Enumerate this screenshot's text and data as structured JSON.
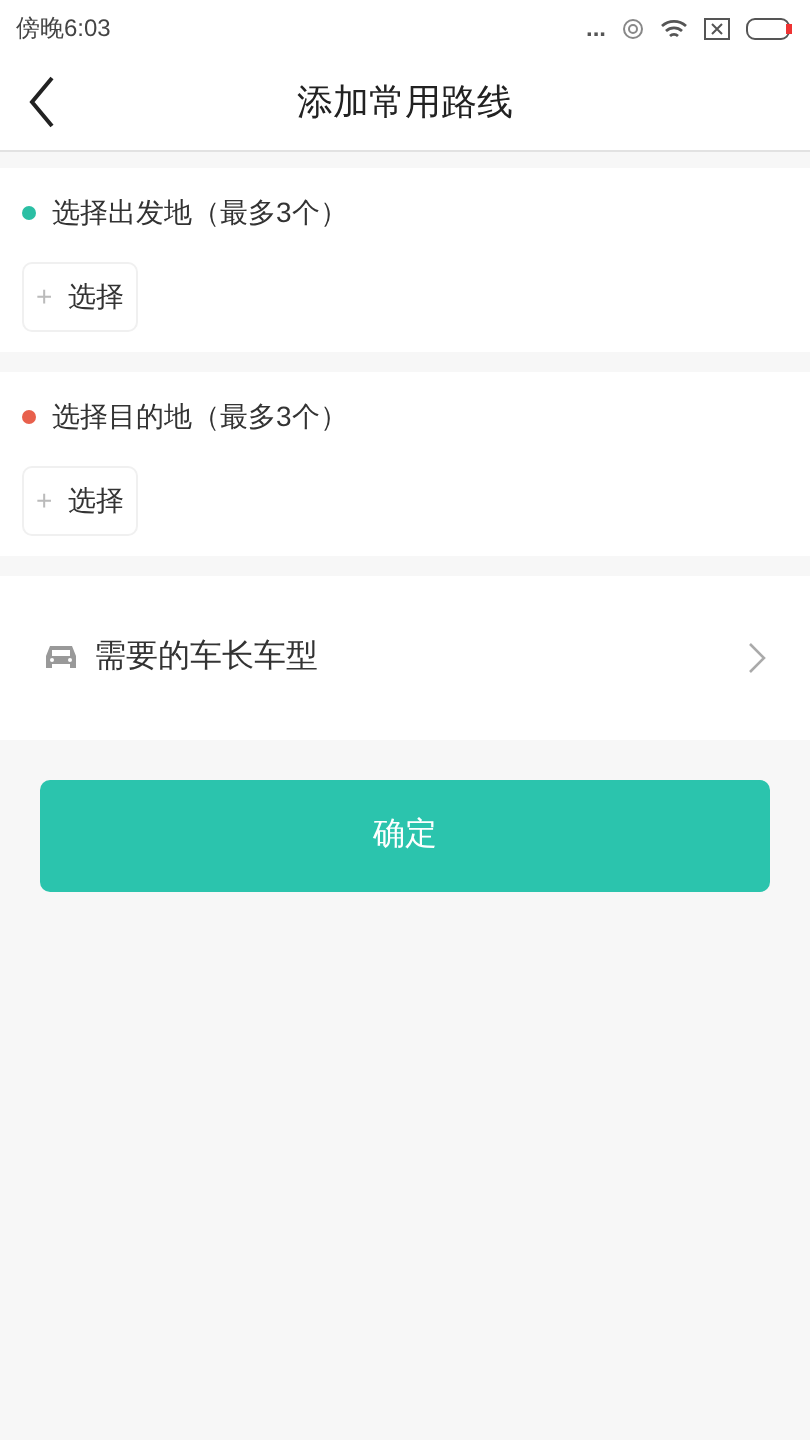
{
  "status_bar": {
    "time": "傍晚6:03",
    "dots": "..."
  },
  "header": {
    "title": "添加常用路线"
  },
  "sections": [
    {
      "label": "选择出发地（最多3个）",
      "color": "#2bbfa4",
      "button": "选择",
      "plus": "+"
    },
    {
      "label": "选择目的地（最多3个）",
      "color": "#e8604c",
      "button": "选择",
      "plus": "+"
    }
  ],
  "vehicle_row": {
    "label": "需要的车长车型"
  },
  "confirm_button": "确定"
}
